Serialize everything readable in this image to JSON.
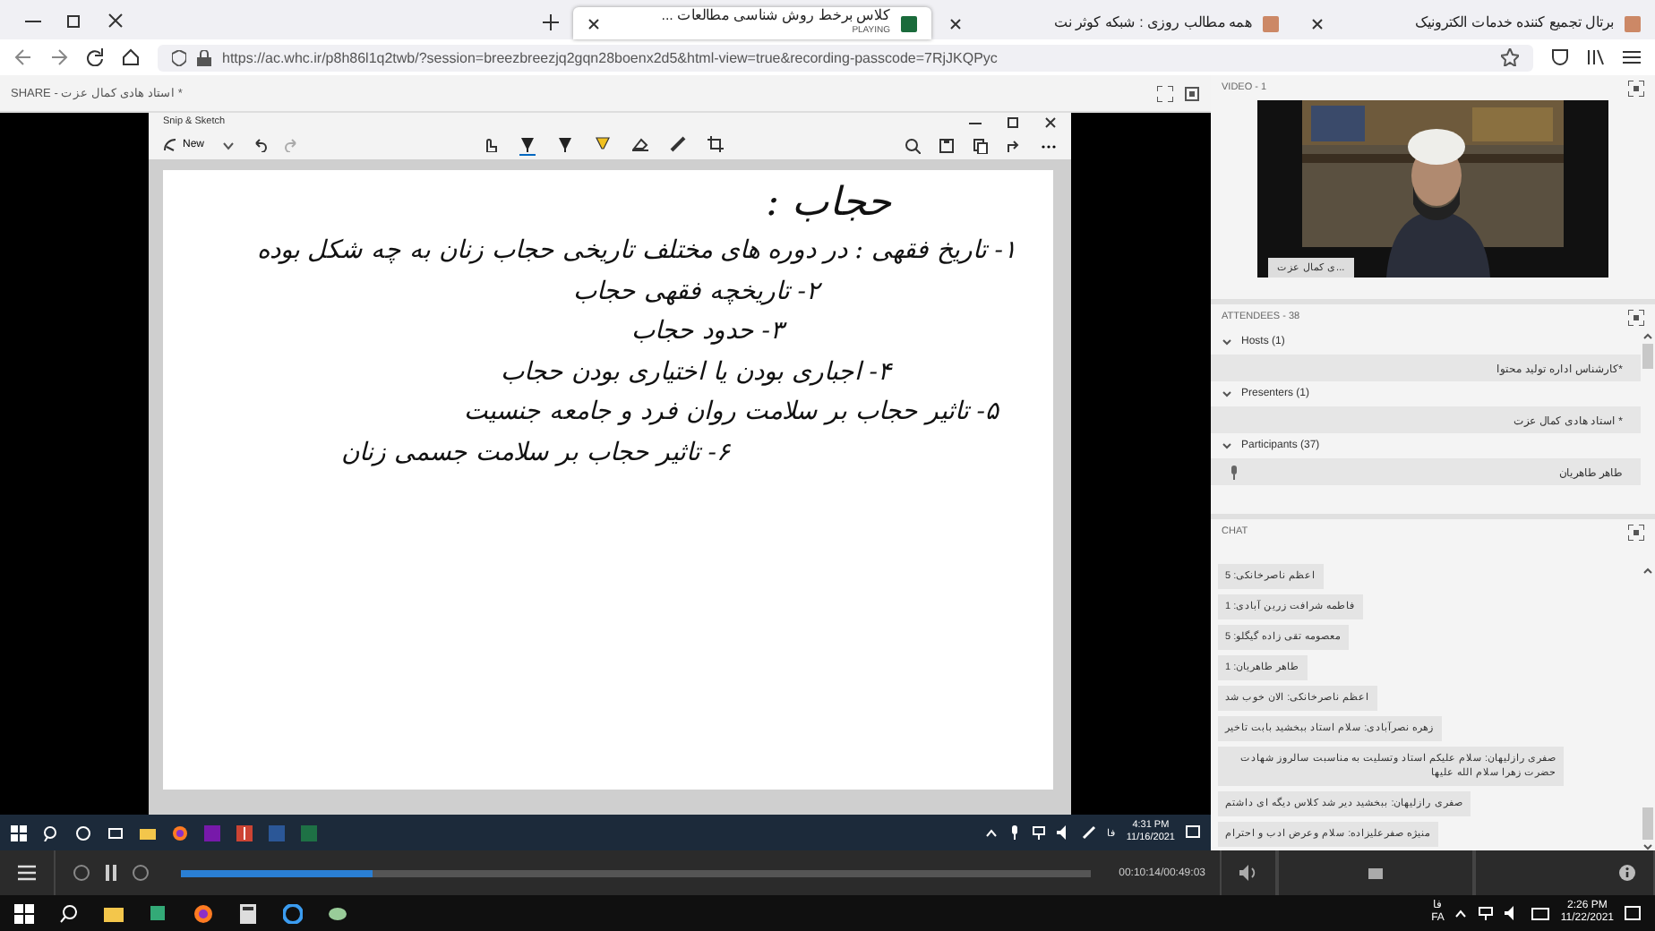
{
  "browser": {
    "tabs": [
      {
        "title": "برتال تجمیع کننده خدمات الکترونیک",
        "selected": false
      },
      {
        "title": "همه مطالب روزی : شبکه کوثر نت",
        "selected": false
      },
      {
        "title": "کلاس برخط روش شناسی مطالعات ...",
        "subtitle": "PLAYING",
        "selected": true
      }
    ],
    "url": "https://ac.whc.ir/p8h86l1q2twb/?session=breezbreezjq2gqn28boenx2d5&html-view=true&recording-passcode=7RjJKQPyc"
  },
  "share": {
    "title": "SHARE - استاد هادی کمال عزت *",
    "snip": {
      "title": "Snip & Sketch",
      "new_label": "New",
      "tools": [
        {
          "kind": "touch",
          "selected": false
        },
        {
          "kind": "pen",
          "selected": true
        },
        {
          "kind": "pen",
          "selected": false
        },
        {
          "kind": "highlighter",
          "selected": false
        },
        {
          "kind": "eraser",
          "selected": false
        },
        {
          "kind": "ruler",
          "selected": false
        },
        {
          "kind": "crop",
          "selected": false
        }
      ],
      "ink": [
        "حجاب :",
        "۱- تاریخ فقهی : در دوره های مختلف تاریخی حجاب زنان به چه شکل بوده",
        "۲- تاریخچه فقهی حجاب",
        "۳- حدود حجاب",
        "۴- اجباری بودن یا اختیاری بودن حجاب",
        "۵- تاثیر حجاب بر سلامت روان فرد و جامعه جنسیت",
        "۶- تاثیر حجاب بر سلامت جسمی زنان"
      ]
    },
    "taskbar": {
      "lang": "فا",
      "time": "4:31 PM",
      "date": "11/16/2021"
    }
  },
  "video": {
    "title": "VIDEO - 1",
    "name_tag": "...ی کمال عزت"
  },
  "attendees": {
    "title": "ATTENDEES - 38",
    "groups": [
      {
        "label": "Hosts (1)",
        "expanded": true,
        "members": [
          "*کارشناس اداره تولید محتوا"
        ]
      },
      {
        "label": "Presenters (1)",
        "expanded": true,
        "members": [
          "* استاد هادی کمال عزت"
        ]
      },
      {
        "label": "Participants (37)",
        "expanded": true,
        "members": [
          "طاهر طاهریان"
        ]
      }
    ]
  },
  "chat": {
    "title": "CHAT",
    "messages": [
      "اعظم ناصرخانکی: 5",
      "فاطمه شرافت زرین آبادی: 1",
      "معصومه تقی زاده گیگلو: 5",
      "طاهر طاهریان: 1",
      "اعظم ناصرخانکی: الان خوب شد",
      "زهره نصرآبادی: سلام استاد ببخشید بابت تاخیر",
      "صفری رازلیهان: سلام علیکم استاد وتسلیت به مناسبت سالروز شهادت حضرت زهرا سلام الله علیها",
      "صفری رازلیهان: ببخشید دیر شد کلاس دیگه ای داشتم",
      "منیژه صفرعلیزاده: سلام وعرض ادب و احترام"
    ]
  },
  "player": {
    "time": "00:10:14/00:49:03",
    "level": 0.21
  },
  "taskbar": {
    "lang": "فا",
    "lang2": "FA",
    "time": "2:26 PM",
    "date": "11/22/2021"
  }
}
